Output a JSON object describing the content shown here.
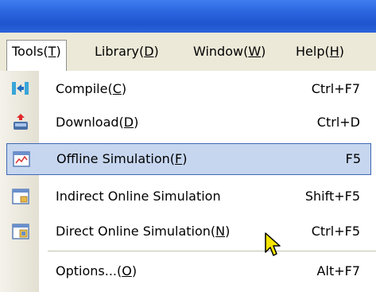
{
  "menubar": {
    "items": [
      {
        "pre": "Tools(",
        "key": "T",
        "post": ")",
        "active": true
      },
      {
        "pre": "Library(",
        "key": "D",
        "post": ")",
        "active": false
      },
      {
        "pre": "Window(",
        "key": "W",
        "post": ")",
        "active": false
      },
      {
        "pre": "Help(",
        "key": "H",
        "post": ")",
        "active": false
      }
    ]
  },
  "menu": {
    "items": [
      {
        "pre": "Compile(",
        "key": "C",
        "post": ")",
        "shortcut": "Ctrl+F7",
        "icon": "compile-icon"
      },
      {
        "pre": "Download(",
        "key": "D",
        "post": ")",
        "shortcut": "Ctrl+D",
        "icon": "download-icon"
      },
      {
        "pre": "Offline Simulation(",
        "key": "F",
        "post": ")",
        "shortcut": "F5",
        "icon": "offline-simulation-icon",
        "highlighted": true
      },
      {
        "pre": "Indirect Online Simulation",
        "key": "",
        "post": "",
        "shortcut": "Shift+F5",
        "icon": "indirect-online-simulation-icon"
      },
      {
        "pre": "Direct Online Simulation(",
        "key": "N",
        "post": ")",
        "shortcut": "Ctrl+F5",
        "icon": "direct-online-simulation-icon"
      },
      {
        "pre": "Options...(",
        "key": "O",
        "post": ")",
        "shortcut": "Alt+F7",
        "icon": ""
      }
    ]
  },
  "colors": {
    "titlebar": "#2a63dd",
    "menubar_bg": "#ece9d8",
    "highlight_bg": "#c6d6ef",
    "highlight_border": "#3f68b6"
  }
}
